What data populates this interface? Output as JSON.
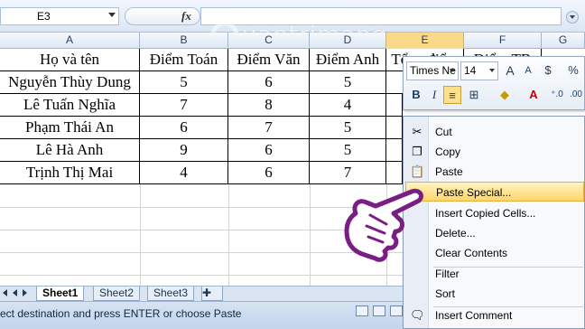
{
  "formula_bar": {
    "name_box": "E3",
    "fx_label": "fx",
    "formula_value": ""
  },
  "columns": [
    "A",
    "B",
    "C",
    "D",
    "E",
    "F",
    "G"
  ],
  "table": {
    "headers": [
      "Họ và tên",
      "Điểm Toán",
      "Điểm Văn",
      "Điểm Anh",
      "Tổng điểm",
      "Điểm TB"
    ],
    "rows": [
      [
        "Nguyễn Thùy Dung",
        "5",
        "6",
        "5"
      ],
      [
        "Lê Tuấn Nghĩa",
        "7",
        "8",
        "4"
      ],
      [
        "Phạm Thái An",
        "6",
        "7",
        "5"
      ],
      [
        "Lê Hà Anh",
        "9",
        "6",
        "5"
      ],
      [
        "Trịnh Thị Mai",
        "4",
        "6",
        "7"
      ]
    ]
  },
  "mini_toolbar": {
    "font_name": "Times Ne",
    "font_size": "14",
    "bold": "B",
    "italic": "I",
    "percent": "%"
  },
  "context_menu": {
    "items": [
      {
        "label": "Cut",
        "icon": "scissors-icon"
      },
      {
        "label": "Copy",
        "icon": "copy-icon"
      },
      {
        "label": "Paste",
        "icon": "paste-icon"
      },
      {
        "label": "Paste Special...",
        "icon": "",
        "highlighted": true
      },
      {
        "label": "Insert Copied Cells...",
        "icon": ""
      },
      {
        "label": "Delete...",
        "icon": ""
      },
      {
        "label": "Clear Contents",
        "icon": ""
      },
      {
        "label": "Filter",
        "icon": ""
      },
      {
        "label": "Sort",
        "icon": ""
      },
      {
        "label": "Insert Comment",
        "icon": "comment-icon"
      }
    ]
  },
  "sheet_tabs": [
    "Sheet1",
    "Sheet2",
    "Sheet3"
  ],
  "active_sheet": "Sheet1",
  "status_text": "ect destination and press ENTER or choose Paste",
  "watermark_text": "uantrimang",
  "colors": {
    "highlight": "#ffd66b",
    "header_bg": "#dde7f3",
    "accent": "#9eb6d4"
  }
}
